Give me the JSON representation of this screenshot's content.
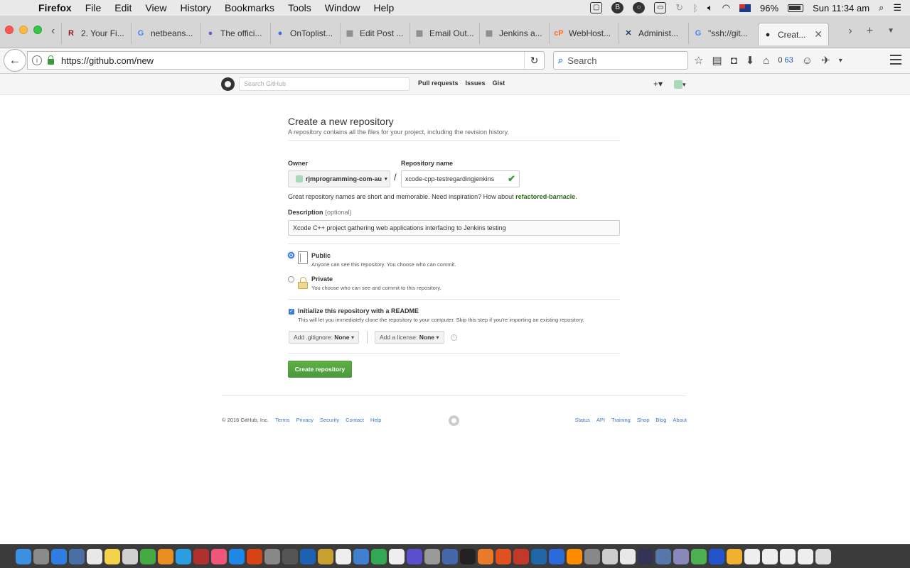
{
  "menubar": {
    "items": [
      "Firefox",
      "File",
      "Edit",
      "View",
      "History",
      "Bookmarks",
      "Tools",
      "Window",
      "Help"
    ],
    "battery": "96%",
    "clock": "Sun 11:34 am"
  },
  "tabs": [
    {
      "label": "2. Your Fi...",
      "fav": "R",
      "color": "#8b1a1a"
    },
    {
      "label": "netbeans...",
      "fav": "G",
      "color": "#4285f4"
    },
    {
      "label": "The offici...",
      "fav": "●",
      "color": "#6a5acd"
    },
    {
      "label": "OnToplist...",
      "fav": "●",
      "color": "#3a6fd8"
    },
    {
      "label": "Edit Post ...",
      "fav": "▦",
      "color": "#888888"
    },
    {
      "label": "Email Out...",
      "fav": "▦",
      "color": "#888888"
    },
    {
      "label": "Jenkins a...",
      "fav": "▦",
      "color": "#888888"
    },
    {
      "label": "WebHost...",
      "fav": "cP",
      "color": "#ff6c2c"
    },
    {
      "label": "Administ...",
      "fav": "✕",
      "color": "#1f3b6e"
    },
    {
      "label": "\"ssh://git...",
      "fav": "G",
      "color": "#4285f4"
    },
    {
      "label": "Creat...",
      "fav": "●",
      "color": "#222222"
    }
  ],
  "navbar": {
    "url": "https://github.com/new",
    "search_placeholder": "Search",
    "counter_a": "0",
    "counter_b": "63"
  },
  "gh_header": {
    "search_placeholder": "Search GitHub",
    "nav": [
      "Pull requests",
      "Issues",
      "Gist"
    ],
    "plus": "+▾",
    "avatar_caret": "▾"
  },
  "form": {
    "title": "Create a new repository",
    "subtitle": "A repository contains all the files for your project, including the revision history.",
    "owner_label": "Owner",
    "owner_value": "rjmprogramming-com-au",
    "slash": "/",
    "repo_label": "Repository name",
    "repo_value": "xcode-cpp-testregardingjenkins",
    "hint_text": "Great repository names are short and memorable. Need inspiration? How about ",
    "hint_suggest": "refactored-barnacle",
    "hint_end": ".",
    "desc_label": "Description",
    "desc_optional": "(optional)",
    "desc_value": "Xcode C++ project gathering web applications interfacing to Jenkins testing",
    "public_title": "Public",
    "public_desc": "Anyone can see this repository. You choose who can commit.",
    "private_title": "Private",
    "private_desc": "You choose who can see and commit to this repository.",
    "readme_title": "Initialize this repository with a README",
    "readme_desc": "This will let you immediately clone the repository to your computer. Skip this step if you're importing an existing repository.",
    "gitignore_label": "Add .gitignore:",
    "gitignore_value": "None",
    "license_label": "Add a license:",
    "license_value": "None",
    "create_label": "Create repository"
  },
  "footer": {
    "copyright": "© 2016 GitHub, Inc.",
    "left_links": [
      "Terms",
      "Privacy",
      "Security",
      "Contact",
      "Help"
    ],
    "right_links": [
      "Status",
      "API",
      "Training",
      "Shop",
      "Blog",
      "About"
    ]
  },
  "dock_colors": [
    "#3d8fe0",
    "#8a8a8a",
    "#2f7de0",
    "#4a6fa5",
    "#e8e8e8",
    "#f4d24a",
    "#d0d0d0",
    "#44aa44",
    "#e88d1f",
    "#2a9ee0",
    "#b03030",
    "#f0567a",
    "#1e88e5",
    "#d84315",
    "#888888",
    "#555555",
    "#1e60b4",
    "#c8a030",
    "#eeeeee",
    "#4080d0",
    "#34a853",
    "#eeeeee",
    "#5a4fcf",
    "#999999",
    "#4466aa",
    "#222222",
    "#e87a2a",
    "#e05020",
    "#c0392b",
    "#2266aa",
    "#2a6ad8",
    "#ff8c00",
    "#888888",
    "#cccccc",
    "#e8e8e8",
    "#333355",
    "#5577aa",
    "#8888bb",
    "#4caf50",
    "#2255cc",
    "#f0b030",
    "#eeeeee",
    "#eeeeee",
    "#eeeeee",
    "#eeeeee",
    "#dddddd"
  ]
}
